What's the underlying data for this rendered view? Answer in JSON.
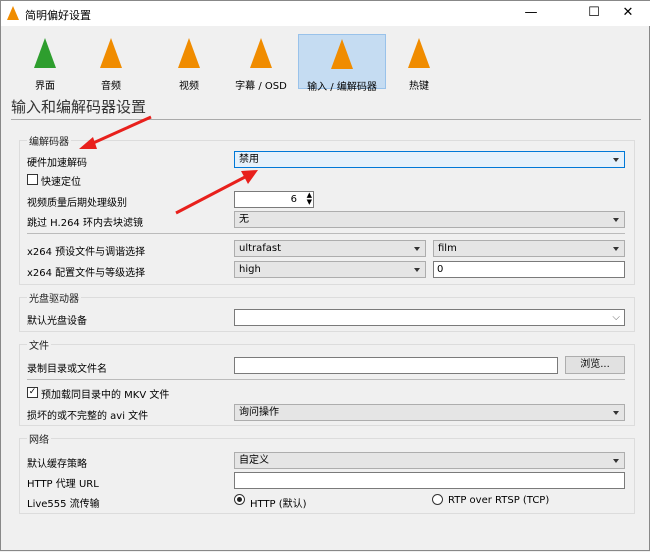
{
  "window": {
    "title": "简明偏好设置",
    "minimize": "—",
    "maximize": "☐",
    "close": "✕"
  },
  "tabs": [
    {
      "label": "界面",
      "color": "#2e9e2e"
    },
    {
      "label": "音频"
    },
    {
      "label": "视频"
    },
    {
      "label": "字幕 / OSD"
    },
    {
      "label": "输入 / 编解码器",
      "selected": true
    },
    {
      "label": "热键"
    }
  ],
  "heading": "输入和编解码器设置",
  "codecs": {
    "title": "编解码器",
    "hw_label": "硬件加速解码",
    "hw_value": "禁用",
    "fast_seek": "快速定位",
    "fast_seek_checked": false,
    "pp_label": "视频质量后期处理级别",
    "pp_value": "6",
    "skip_label": "跳过 H.264 环内去块滤镜",
    "skip_value": "无",
    "preset_label": "x264 预设文件与调谐选择",
    "preset_value": "ultrafast",
    "tune_value": "film",
    "profile_label": "x264 配置文件与等级选择",
    "profile_value": "high",
    "level_value": "0"
  },
  "disc": {
    "title": "光盘驱动器",
    "device_label": "默认光盘设备",
    "device_value": ""
  },
  "files": {
    "title": "文件",
    "record_label": "录制目录或文件名",
    "record_value": "",
    "browse": "浏览...",
    "preload_label": "预加载同目录中的 MKV 文件",
    "preload_checked": true,
    "avi_label": "损坏的或不完整的 avi 文件",
    "avi_value": "询问操作"
  },
  "network": {
    "title": "网络",
    "cache_label": "默认缓存策略",
    "cache_value": "自定义",
    "proxy_label": "HTTP 代理 URL",
    "proxy_value": "",
    "live_label": "Live555 流传输",
    "opt_http": "HTTP (默认)",
    "opt_rtsp": "RTP over RTSP (TCP)"
  },
  "colors": {
    "accent": "#0078d7",
    "annotation": "#e8201c"
  }
}
